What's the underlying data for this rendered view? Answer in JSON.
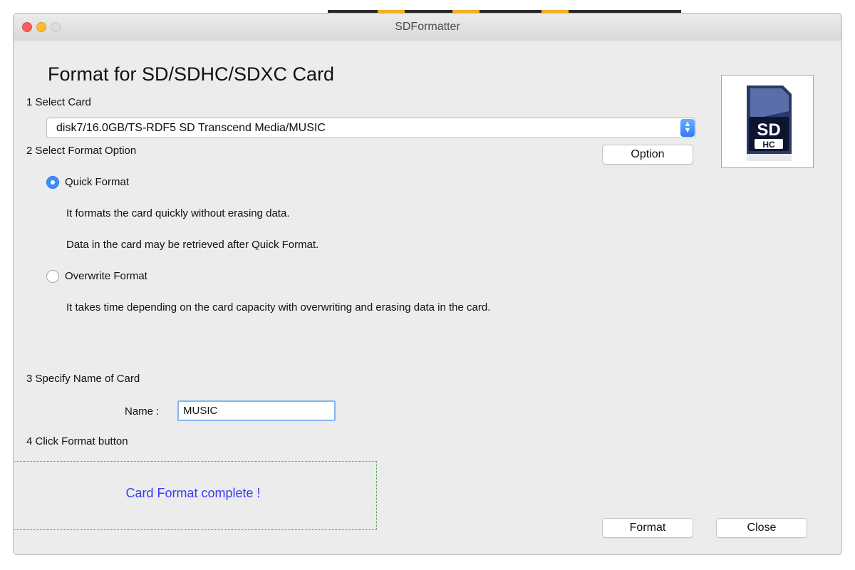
{
  "window": {
    "title": "SDFormatter"
  },
  "heading": "Format for SD/SDHC/SDXC Card",
  "step1": {
    "label": "1 Select Card",
    "selected_card": "disk7/16.0GB/TS-RDF5 SD Transcend Media/MUSIC"
  },
  "step2": {
    "label": "2 Select Format Option",
    "option_button": "Option",
    "quick": {
      "label": "Quick Format",
      "selected": true,
      "desc1": "It formats the card quickly without erasing data.",
      "desc2": "Data in the card may be retrieved after Quick Format."
    },
    "overwrite": {
      "label": "Overwrite Format",
      "selected": false,
      "desc": "It takes time depending on the card capacity with overwriting and erasing data in the card."
    }
  },
  "step3": {
    "label": "3 Specify Name of Card",
    "name_label": "Name :",
    "name_value": "MUSIC"
  },
  "step4": {
    "label": "4 Click Format button"
  },
  "status": {
    "message": "Card Format complete !"
  },
  "buttons": {
    "format": "Format",
    "close": "Close"
  },
  "colors": {
    "accent": "#3d8ef5",
    "status_text": "#3c3cf0",
    "status_border": "#2fa52f",
    "close_light": "#fc5f57",
    "minimize_light": "#fdbc2e"
  },
  "icons": [
    "sd-card-icon",
    "radio-selected-icon",
    "radio-unselected-icon",
    "popup-arrows-icon"
  ]
}
